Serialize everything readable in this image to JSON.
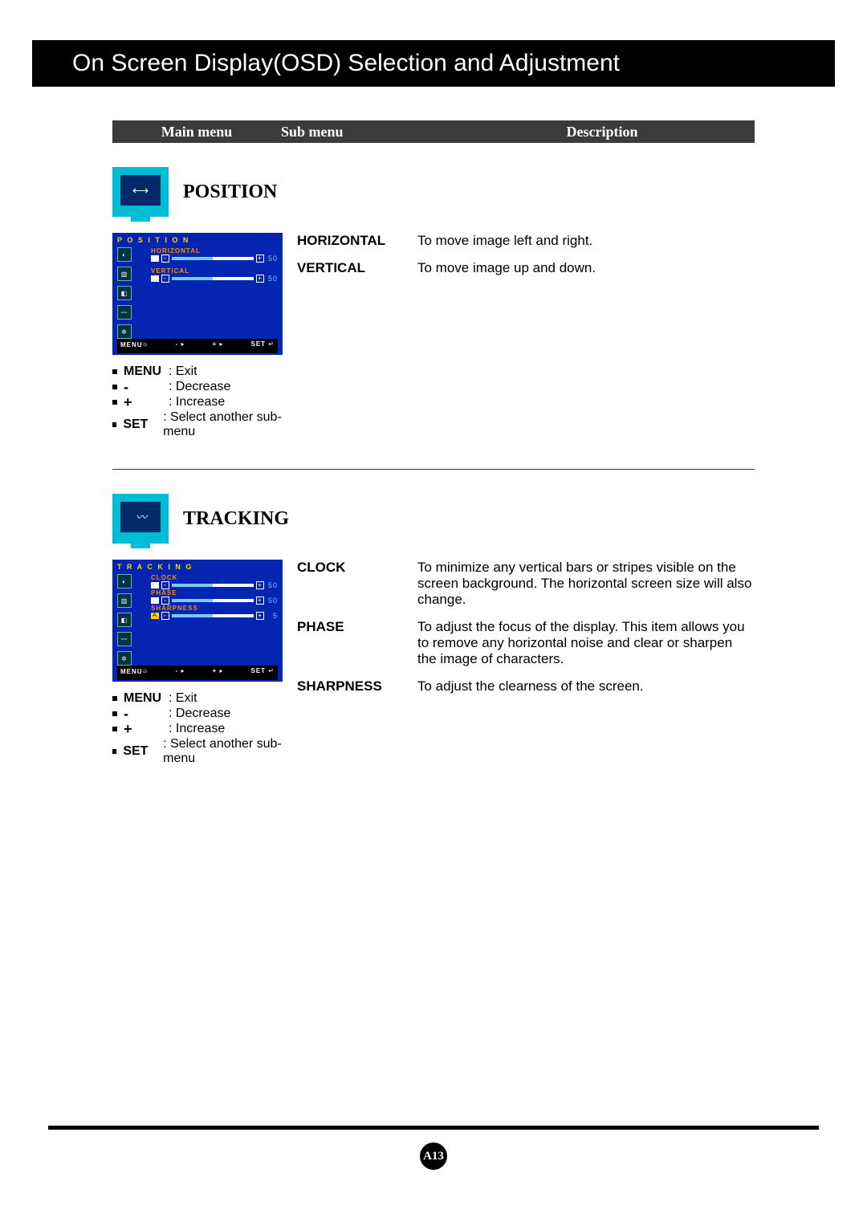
{
  "page_title": "On Screen Display(OSD) Selection and Adjustment",
  "columns": {
    "main": "Main menu",
    "sub": "Sub menu",
    "desc": "Description"
  },
  "sections": [
    {
      "title": "POSITION",
      "icon_glyph": "⟷",
      "osd": {
        "title": "P O S I T I O N",
        "items": [
          {
            "label": "HORIZONTAL",
            "value": "50"
          },
          {
            "label": "VERTICAL",
            "value": "50"
          }
        ],
        "footer": {
          "menu": "MENU",
          "minus": "-",
          "plus": "+",
          "set": "SET"
        }
      },
      "rows": [
        {
          "sub": "HORIZONTAL",
          "desc": "To move image left and right."
        },
        {
          "sub": "VERTICAL",
          "desc": "To move image up and down."
        }
      ],
      "legend": [
        {
          "key": "MENU",
          "text": ": Exit"
        },
        {
          "sym": "-",
          "text": ": Decrease"
        },
        {
          "sym": "+",
          "text": ": Increase"
        },
        {
          "key": "SET",
          "text": ": Select another sub-menu"
        }
      ]
    },
    {
      "title": "TRACKING",
      "icon_glyph": "〰",
      "osd": {
        "title": "T R A C K I N G",
        "items": [
          {
            "label": "CLOCK",
            "value": "50"
          },
          {
            "label": "PHASE",
            "value": "50"
          },
          {
            "label": "SHARPNESS",
            "value": "5"
          }
        ],
        "footer": {
          "menu": "MENU",
          "minus": "-",
          "plus": "+",
          "set": "SET"
        }
      },
      "rows": [
        {
          "sub": "CLOCK",
          "desc": "To minimize any vertical bars or stripes visible on the screen background. The horizontal screen size will also change."
        },
        {
          "sub": "PHASE",
          "desc": "To adjust the focus of the display. This item allows you to remove any horizontal noise and clear or sharpen the image of characters."
        },
        {
          "sub": "SHARPNESS",
          "desc": "To adjust the clearness of the screen."
        }
      ],
      "legend": [
        {
          "key": "MENU",
          "text": ": Exit"
        },
        {
          "sym": "-",
          "text": ": Decrease"
        },
        {
          "sym": "+",
          "text": ": Increase"
        },
        {
          "key": "SET",
          "text": ": Select another sub-menu"
        }
      ]
    }
  ],
  "page_number": "A13"
}
